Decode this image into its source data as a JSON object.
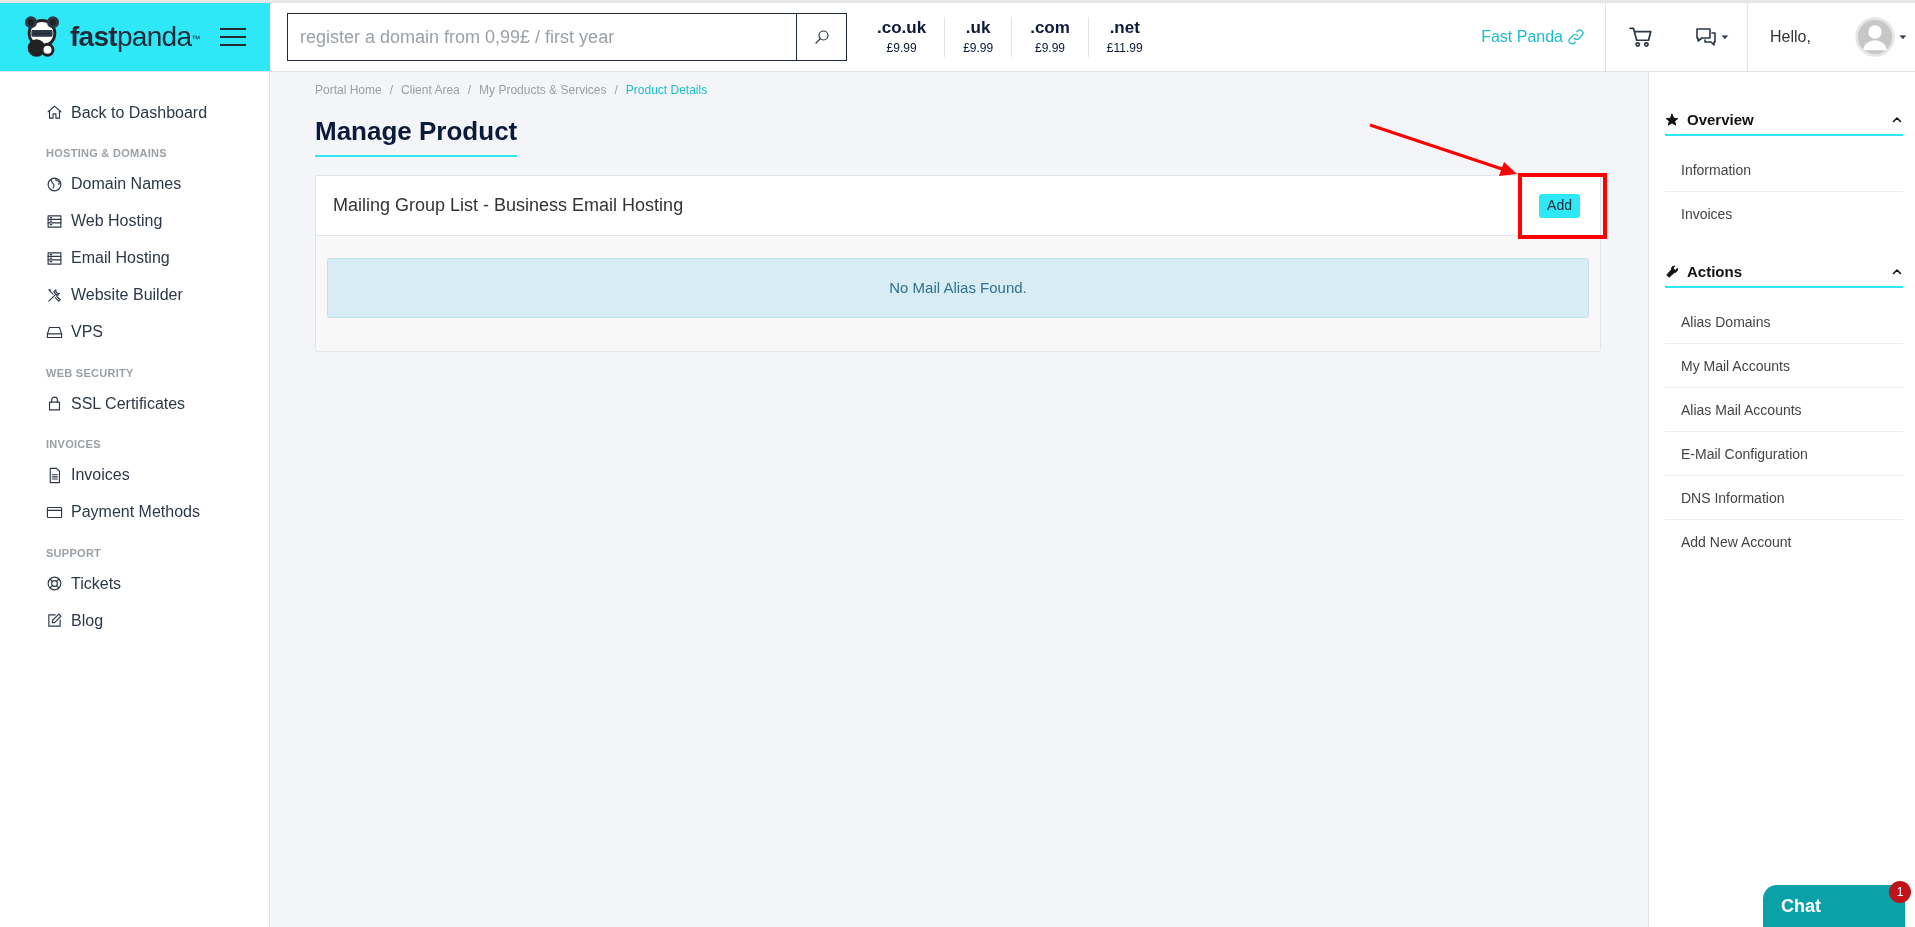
{
  "header": {
    "brand": "fastpanda",
    "brand_mark": "™",
    "search": {
      "placeholder": "register a domain from 0,99£ / first year"
    },
    "tlds": [
      {
        "name": ".co.uk",
        "price": "£9.99"
      },
      {
        "name": ".uk",
        "price": "£9.99"
      },
      {
        "name": ".com",
        "price": "£9.99"
      },
      {
        "name": ".net",
        "price": "£11.99"
      }
    ],
    "site_link": "Fast Panda",
    "greeting": "Hello,"
  },
  "sidebar": {
    "back": "Back to Dashboard",
    "sections": [
      {
        "heading": "HOSTING & DOMAINS",
        "items": [
          "Domain Names",
          "Web Hosting",
          "Email Hosting",
          "Website Builder",
          "VPS"
        ]
      },
      {
        "heading": "WEB SECURITY",
        "items": [
          "SSL Certificates"
        ]
      },
      {
        "heading": "INVOICES",
        "items": [
          "Invoices",
          "Payment Methods"
        ]
      },
      {
        "heading": "SUPPORT",
        "items": [
          "Tickets",
          "Blog"
        ]
      }
    ]
  },
  "breadcrumb": [
    {
      "label": "Portal Home",
      "current": false
    },
    {
      "separator": "/",
      "label": "Client Area",
      "current": false
    },
    {
      "separator": "/",
      "label": "My Products & Services",
      "current": false
    },
    {
      "separator": "/",
      "label": "Product Details",
      "current": true
    }
  ],
  "page_title": "Manage Product",
  "card": {
    "title": "Mailing Group List - Business Email Hosting",
    "button": "Add",
    "alert": "No Mail Alias Found."
  },
  "right_panel": [
    {
      "title": "Overview",
      "expanded": true,
      "items": [
        "Information",
        "Invoices"
      ]
    },
    {
      "title": "Actions",
      "expanded": true,
      "items": [
        "Alias Domains",
        "My Mail Accounts",
        "Alias Mail Accounts",
        "E-Mail Configuration",
        "DNS Information",
        "Add New Account"
      ]
    }
  ],
  "chat": {
    "label": "Chat",
    "badge": "1"
  }
}
